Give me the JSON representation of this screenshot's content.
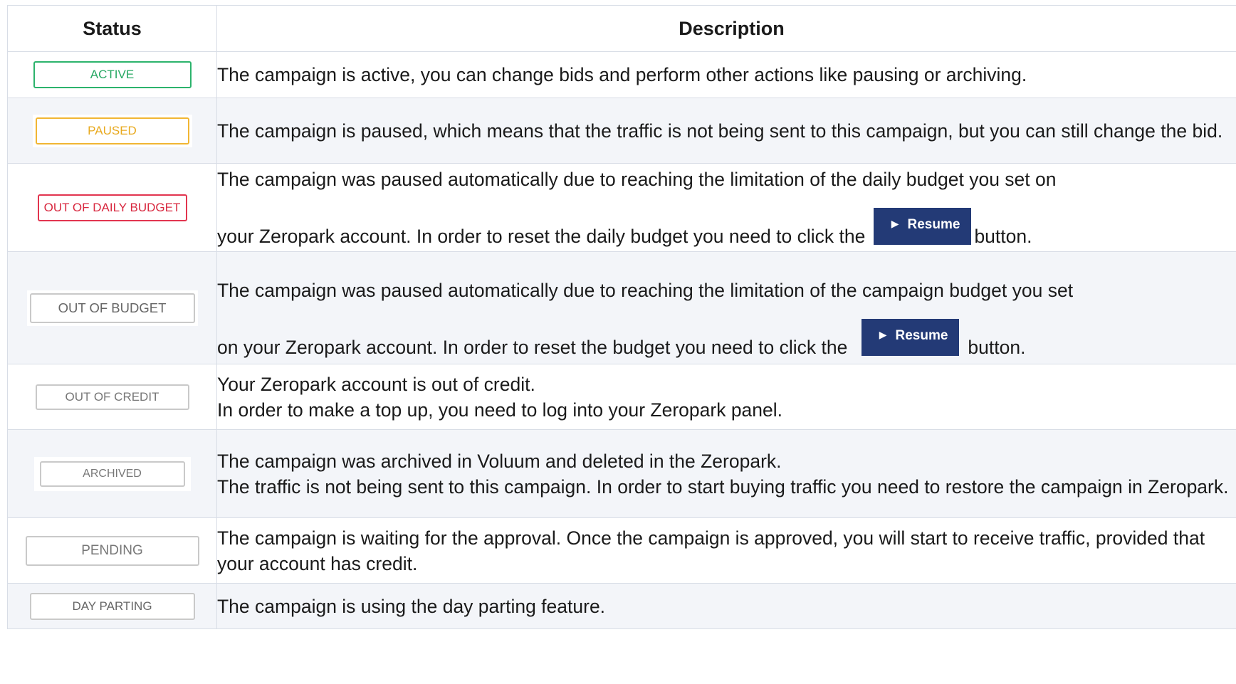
{
  "table": {
    "headers": {
      "status": "Status",
      "description": "Description"
    },
    "rows": [
      {
        "badge": "ACTIVE",
        "text": "The campaign is active, you can change bids and perform other actions like pausing or archiving."
      },
      {
        "badge": "PAUSED",
        "text": "The campaign is paused, which means that the traffic is not being sent to this campaign, but you can still change the bid."
      },
      {
        "badge": "OUT OF DAILY BUDGET",
        "text_line1": "The campaign was paused automatically due to reaching the limitation of the daily budget you set on",
        "text_line2_before": "your Zeropark account. In order to reset the daily budget you need to click the",
        "button": "Resume",
        "text_after": "button."
      },
      {
        "badge": "OUT OF BUDGET",
        "text_line1": "The campaign was paused automatically due to reaching the limitation of the campaign budget you set",
        "text_line2_before": "on your Zeropark account. In order to reset the budget you need to click the",
        "button": "Resume",
        "text_after": "button."
      },
      {
        "badge": "OUT OF CREDIT",
        "text_line1": "Your Zeropark account is out of credit.",
        "text_line2": "In order to make a top up, you need to log into your Zeropark panel."
      },
      {
        "badge": "ARCHIVED",
        "text_line1": "The campaign was archived in Voluum and deleted in the Zeropark.",
        "text_line2": "The traffic is not being sent to this campaign. In order to start buying traffic you need to restore the campaign in Zeropark."
      },
      {
        "badge": "PENDING",
        "text": "The campaign is waiting for the approval. Once the campaign is approved, you will start to receive traffic, provided that your account has credit."
      },
      {
        "badge": "DAY PARTING",
        "text": "The campaign is using the day parting feature."
      }
    ]
  },
  "colors": {
    "active": "#2cb36c",
    "paused": "#f1b633",
    "out_of_daily_budget": "#e2354f",
    "neutral_border": "#c9c9c9",
    "resume_button_bg": "#233a76",
    "alt_row_bg": "#f3f5f9"
  },
  "icons": {
    "resume": "play-icon"
  }
}
